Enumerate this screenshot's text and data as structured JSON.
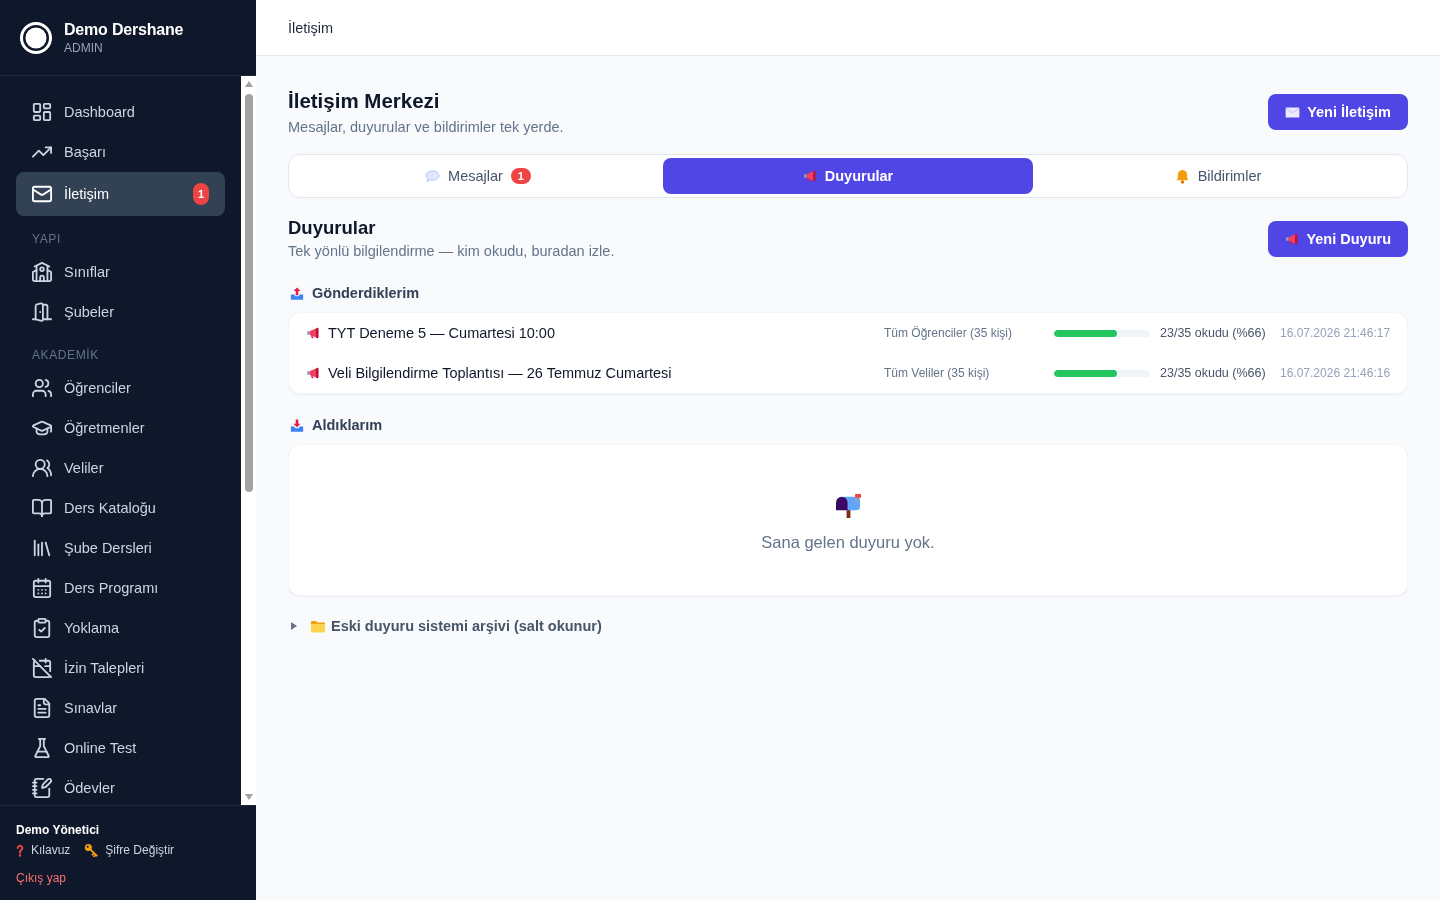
{
  "sidebar": {
    "brand": {
      "name": "Demo Dershane",
      "role": "ADMIN"
    },
    "sections": [
      {
        "items": [
          {
            "label": "Dashboard",
            "selected": false
          },
          {
            "label": "Başarı",
            "selected": false
          },
          {
            "label": "İletişim",
            "selected": true,
            "badge": "1"
          }
        ]
      },
      {
        "heading": "YAPI",
        "items": [
          {
            "label": "Sınıflar",
            "selected": false
          },
          {
            "label": "Şubeler",
            "selected": false
          }
        ]
      },
      {
        "heading": "AKADEMİK",
        "items": [
          {
            "label": "Öğrenciler",
            "selected": false
          },
          {
            "label": "Öğretmenler",
            "selected": false
          },
          {
            "label": "Veliler",
            "selected": false
          },
          {
            "label": "Ders Kataloğu",
            "selected": false
          },
          {
            "label": "Şube Dersleri",
            "selected": false
          },
          {
            "label": "Ders Programı",
            "selected": false
          },
          {
            "label": "Yoklama",
            "selected": false
          },
          {
            "label": "İzin Talepleri",
            "selected": false
          },
          {
            "label": "Sınavlar",
            "selected": false
          },
          {
            "label": "Online Test",
            "selected": false
          },
          {
            "label": "Ödevler",
            "selected": false
          }
        ]
      }
    ],
    "footer": {
      "user": "Demo Yönetici",
      "links": [
        {
          "label": "Kılavuz"
        },
        {
          "label": "Şifre Değiştir"
        }
      ],
      "logout": "Çıkış yap"
    }
  },
  "topbar": {
    "title": "İletişim"
  },
  "header": {
    "title": "İletişim Merkezi",
    "subtitle": "Mesajlar, duyurular ve bildirimler tek yerde.",
    "button": "Yeni İletişim"
  },
  "tabs": [
    {
      "label": "Mesajlar",
      "badge": "1",
      "selected": false
    },
    {
      "label": "Duyurular",
      "selected": true
    },
    {
      "label": "Bildirimler",
      "selected": false
    }
  ],
  "announcements": {
    "title": "Duyurular",
    "subtitle": "Tek yönlü bilgilendirme — kim okudu, buradan izle.",
    "button": "Yeni Duyuru",
    "sent": {
      "heading": "Gönderdiklerim",
      "rows": [
        {
          "title": "TYT Deneme 5 — Cumartesi 10:00",
          "audience": "Tüm Öğrenciler (35 kişi)",
          "level": 0.66,
          "reading": "23/35 okudu (%66)",
          "date": "16.07.2026 21:46:17"
        },
        {
          "title": "Veli Bilgilendirme Toplantısı — 26 Temmuz Cumartesi",
          "audience": "Tüm Veliler (35 kişi)",
          "level": 0.66,
          "reading": "23/35 okudu (%66)",
          "date": "16.07.2026 21:46:16"
        }
      ]
    },
    "received": {
      "heading": "Aldıklarım",
      "empty_text": "Sana gelen duyuru yok."
    },
    "archive": {
      "label": "Eski duyuru sistemi arşivi (salt okunur)",
      "expanded": false
    }
  }
}
